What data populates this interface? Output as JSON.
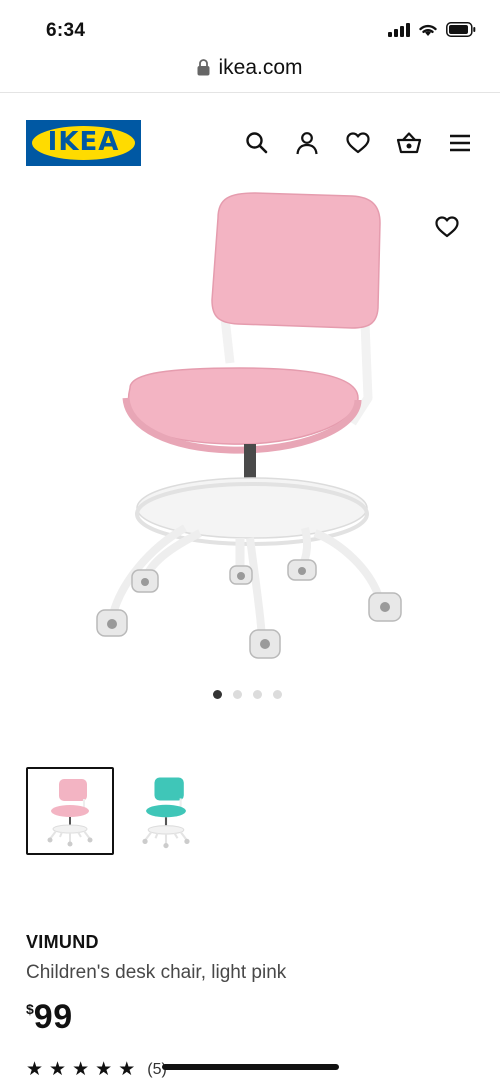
{
  "status_bar": {
    "time": "6:34"
  },
  "browser": {
    "url": "ikea.com"
  },
  "header": {
    "logo_text": "IKEA",
    "icons": [
      "search-icon",
      "account-icon",
      "heart-icon",
      "basket-icon",
      "menu-icon"
    ]
  },
  "colors": {
    "brand_blue": "#0058a3",
    "brand_yellow": "#ffdb00",
    "product_pink": "#f3b4c3",
    "variant_turquoise": "#3fc6b8"
  },
  "carousel": {
    "slide_count": 4,
    "active_index": 0
  },
  "thumbnails": [
    {
      "variant": "light pink",
      "selected": true
    },
    {
      "variant": "turquoise",
      "selected": false
    }
  ],
  "product": {
    "name": "VIMUND",
    "description": "Children's desk chair, light pink",
    "currency_symbol": "$",
    "price": "99",
    "rating_stars": 5,
    "review_count": "(5)"
  }
}
